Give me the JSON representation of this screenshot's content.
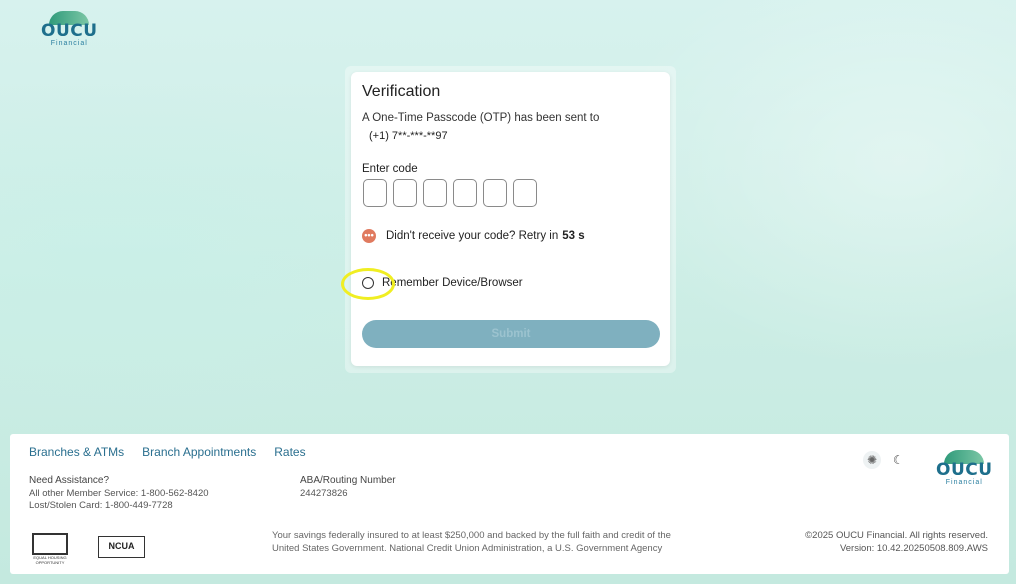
{
  "brand": {
    "name": "OUCU",
    "sub": "Financial"
  },
  "verification": {
    "title": "Verification",
    "otp_message": "A One-Time Passcode (OTP) has been sent to",
    "phone": "(+1) 7**-***-**97",
    "enter_code_label": "Enter code",
    "code_boxes": [
      "",
      "",
      "",
      "",
      "",
      ""
    ],
    "retry_text": "Didn't receive your code? Retry in",
    "retry_seconds": "53 s",
    "remember_label": "Remember Device/Browser",
    "submit_label": "Submit"
  },
  "footer": {
    "links": [
      "Branches & ATMs",
      "Branch Appointments",
      "Rates"
    ],
    "assistance": {
      "heading": "Need Assistance?",
      "member_service": "All other Member Service: 1-800-562-8420",
      "lost_card": "Lost/Stolen Card: 1-800-449-7728"
    },
    "aba": {
      "heading": "ABA/Routing Number",
      "value": "244273826"
    },
    "insured_text": "Your savings federally insured to at least $250,000 and backed by the full faith and credit of the United States Government. National Credit Union Administration, a U.S. Government Agency",
    "copyright": "©2025 OUCU Financial. All rights reserved.",
    "version": "Version: 10.42.20250508.809.AWS",
    "ncua_label": "NCUA",
    "ehl_label": "EQUAL HOUSING OPPORTUNITY",
    "theme_icons": [
      "sun-icon",
      "moon-icon"
    ]
  },
  "colors": {
    "accent": "#2a6f8f",
    "submit_bg": "#7fb0bf",
    "retry_icon": "#e07a5f",
    "highlight": "#f0ee22"
  }
}
